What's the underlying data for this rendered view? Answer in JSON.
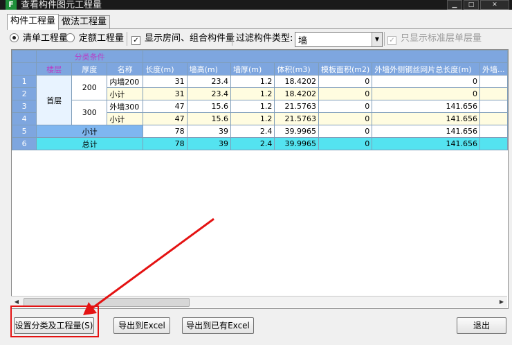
{
  "window": {
    "title": "查看构件图元工程量",
    "icon_glyph": "F"
  },
  "tabs": [
    {
      "label": "构件工程量",
      "active": true
    },
    {
      "label": "做法工程量",
      "active": false
    }
  ],
  "options": {
    "radio_bill": "清单工程量",
    "radio_quota": "定额工程量",
    "show_rooms": "显示房间、组合构件量",
    "filter_label": "过滤构件类型:",
    "filter_value": "墙",
    "std_floor_only": "只显示标准层单层量"
  },
  "grid": {
    "group_header": "分类条件",
    "headers": {
      "floor": "楼层",
      "thickness": "厚度",
      "name": "名称",
      "length": "长度(m)",
      "height": "墙高(m)",
      "wall_thick": "墙厚(m)",
      "volume": "体积(m3)",
      "formwork": "模板面积(m2)",
      "mesh_len": "外墙外侧钢丝网片总长度(m)",
      "cut": "外墙..."
    },
    "rows": [
      {
        "rn": "1",
        "floor": "首层",
        "thickness": "200",
        "name": "内墙200",
        "length": "31",
        "height": "23.4",
        "wall_thick": "1.2",
        "volume": "18.4202",
        "formwork": "0",
        "mesh": "0"
      },
      {
        "rn": "2",
        "name": "小计",
        "length": "31",
        "height": "23.4",
        "wall_thick": "1.2",
        "volume": "18.4202",
        "formwork": "0",
        "mesh": "0"
      },
      {
        "rn": "3",
        "thickness": "300",
        "name": "外墙300",
        "length": "47",
        "height": "15.6",
        "wall_thick": "1.2",
        "volume": "21.5763",
        "formwork": "0",
        "mesh": "141.656"
      },
      {
        "rn": "4",
        "name": "小计",
        "length": "47",
        "height": "15.6",
        "wall_thick": "1.2",
        "volume": "21.5763",
        "formwork": "0",
        "mesh": "141.656"
      },
      {
        "rn": "5",
        "name": "小计",
        "length": "78",
        "height": "39",
        "wall_thick": "2.4",
        "volume": "39.9965",
        "formwork": "0",
        "mesh": "141.656"
      },
      {
        "rn": "6",
        "name": "总计",
        "length": "78",
        "height": "39",
        "wall_thick": "2.4",
        "volume": "39.9965",
        "formwork": "0",
        "mesh": "141.656"
      }
    ]
  },
  "buttons": {
    "set_class": "设置分类及工程量(S)",
    "export_excel": "导出到Excel",
    "export_existing": "导出到已有Excel",
    "exit": "退出"
  },
  "colors": {
    "annotation": "#e41212",
    "grid_header": "#7ea6df",
    "total_row": "#54e3f0"
  }
}
